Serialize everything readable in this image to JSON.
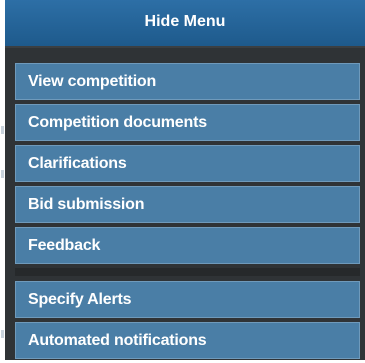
{
  "menu": {
    "hide_label": "Hide Menu",
    "primary_items": [
      {
        "label": "View competition"
      },
      {
        "label": "Competition documents"
      },
      {
        "label": "Clarifications"
      },
      {
        "label": "Bid submission"
      },
      {
        "label": "Feedback"
      }
    ],
    "secondary_items": [
      {
        "label": "Specify Alerts"
      },
      {
        "label": "Automated notifications"
      }
    ]
  },
  "colors": {
    "header": "#1e5a8c",
    "item": "#4a7ea6",
    "panel": "#2f3336"
  }
}
